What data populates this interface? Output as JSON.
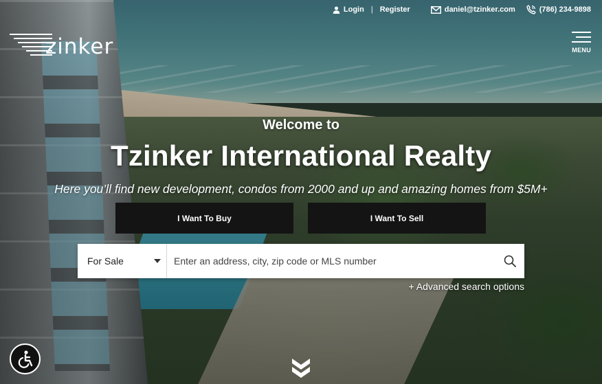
{
  "topbar": {
    "login": "Login",
    "register": "Register",
    "separator": "|",
    "email": "daniel@tzinker.com",
    "phone": "(786) 234-9898"
  },
  "logo": {
    "text": "zinker"
  },
  "menu": {
    "label": "MENU"
  },
  "hero": {
    "welcome": "Welcome to",
    "title": "Tzinker International Realty",
    "subtitle": "Here you’ll find new development, condos from 2000 and up and amazing homes from $5M+",
    "buy_label": "I Want To Buy",
    "sell_label": "I Want To Sell"
  },
  "search": {
    "type_value": "For Sale",
    "placeholder": "Enter an address, city, zip code or MLS number",
    "advanced_label": "+ Advanced search options"
  },
  "icons": {
    "user": "user-icon",
    "email": "envelope-icon",
    "phone": "phone-icon",
    "search": "search-icon",
    "scroll": "chevron-double-down-icon",
    "accessibility": "accessibility-icon",
    "menu": "hamburger-icon"
  }
}
